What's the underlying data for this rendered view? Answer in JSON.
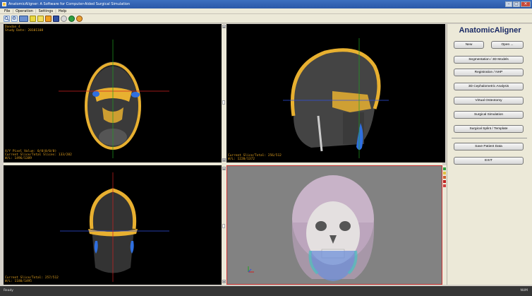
{
  "window": {
    "title": "AnatomicAligner: A Software for Computer-Aided Surgical Simulation",
    "controls": [
      "–",
      "□",
      "×"
    ]
  },
  "menu": {
    "items": [
      "File",
      "Operation",
      "Settings",
      "Help"
    ]
  },
  "toolbar": {
    "icons": [
      "zoom-in-icon",
      "zoom-out-icon",
      "layout-icon",
      "window-level-icon",
      "measure-icon",
      "crosshair-icon",
      "color-icon",
      "reset-icon",
      "settings-icon"
    ]
  },
  "viewports": {
    "axial": {
      "patient": "Dandan 4",
      "study_date": "Study Date: 20101108",
      "pixel_value": "X/Y Pixel Value: 0/0(0/0/0)",
      "slice": "Current Slice/Total Slices: 133/282",
      "wl": "W/L: 1496/1389"
    },
    "sagittal": {
      "slice": "Current Slice/Total: 256/512",
      "wl": "W/L: 1220/1372"
    },
    "coronal": {
      "slice": "Current Slice/Total: 257/512",
      "wl": "W/L: 1180/1495"
    }
  },
  "panel": {
    "app_name": "AnatomicAligner",
    "new_label": "New",
    "open_label": "Open ...",
    "segmentation_label": "Segmentation / 3D Models",
    "registration_label": "Registration / NHP",
    "ceph_label": "3D Cephalometric Analysis",
    "osteotomy_label": "Virtual Osteotomy",
    "simulation_label": "Surgical Simulation",
    "splint_label": "Surgical Splint / Template",
    "save_label": "Save Patient Data",
    "exit_label": "EXIT"
  },
  "status": {
    "left": "Ready",
    "right": "NUM"
  },
  "colors": {
    "accent": "#1a2a66",
    "overlay_text": "#e0a020",
    "bone": "#e8b030",
    "airway": "#2f6fe0",
    "crosshair_red": "#d02020",
    "crosshair_green": "#20a020",
    "crosshair_blue": "#3050e0"
  }
}
